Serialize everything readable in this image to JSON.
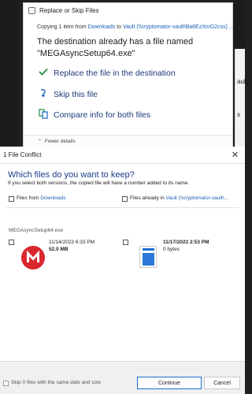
{
  "background": {
    "right_panel_fragments": [
      "ault",
      "s"
    ]
  },
  "replace_skip_dialog": {
    "title": "Replace or Skip Files",
    "copying": {
      "prefix": "Copying 1 item from ",
      "source": "Downloads",
      "middle": " to ",
      "destination": "Vault (\\\\cryptomator-vault\\Ba6EzXmG2css) ..."
    },
    "heading": "The destination already has a file named \"MEGAsyncSetup64.exe\"",
    "options": [
      {
        "icon": "checkmark-icon",
        "label": "Replace the file in the destination"
      },
      {
        "icon": "skip-icon",
        "label": "Skip this file"
      },
      {
        "icon": "compare-icon",
        "label": "Compare info for both files"
      }
    ],
    "fewer_details": "Fewer details"
  },
  "file_conflict_dialog": {
    "title": "1 File Conflict",
    "heading": "Which files do you want to keep?",
    "subtitle": "If you select both versions, the copied file will have a number added to its name.",
    "left_column": {
      "prefix": "Files from ",
      "link": "Downloads"
    },
    "right_column": {
      "prefix": "Files already in ",
      "link": "Vault (\\\\cryptomator-vault\\..."
    },
    "file_name": "MEGAsyncSetup64.exe",
    "source_file": {
      "date": "11/14/2023 6:33 PM",
      "size": "52.0 MB"
    },
    "dest_file": {
      "date": "11/17/2023 2:53 PM",
      "size": "0 bytes"
    },
    "skip_label": "Skip 0 files with the same date and size",
    "continue_label": "Continue",
    "cancel_label": "Cancel",
    "accent_color": "#1a6fd0",
    "mega_color": "#d9272e"
  }
}
